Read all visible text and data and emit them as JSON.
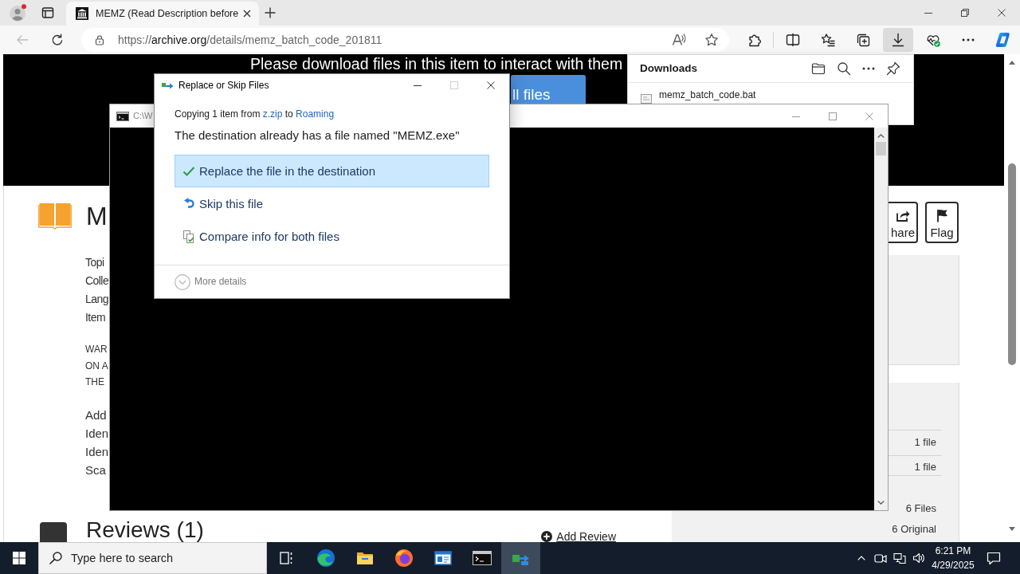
{
  "browser": {
    "tabs": [
      {
        "title": "MEMZ (Read Description before",
        "selected": true
      }
    ],
    "back_disabled": true,
    "url": {
      "scheme": "https://",
      "host": "archive.org",
      "path": "/details/memz_batch_code_201811"
    },
    "toolbar": [
      {
        "kind": "extensions",
        "active": false
      },
      {
        "kind": "split_screen",
        "active": false
      },
      {
        "kind": "favorites",
        "active": false
      },
      {
        "kind": "collections",
        "active": false
      },
      {
        "kind": "downloads",
        "active": true
      },
      {
        "kind": "essentials",
        "active": false
      },
      {
        "kind": "more",
        "active": false
      },
      {
        "kind": "assistant",
        "active": false
      }
    ]
  },
  "page": {
    "banner": {
      "notice": "Please download files in this item to interact with them",
      "button": "ll files"
    },
    "title": "M",
    "metadata": [
      "Topi",
      "Colle",
      "Lang",
      "Item"
    ],
    "warning": [
      "WAR",
      "ON A",
      "THE"
    ],
    "details": [
      "Add",
      "Iden",
      "Iden",
      "Sca"
    ],
    "actions": [
      {
        "kind": "share",
        "label": "hare"
      },
      {
        "kind": "flag",
        "label": "Flag"
      }
    ],
    "file_rows": [
      "1 file",
      "1 file"
    ],
    "totals": [
      "6 Files",
      "6 Original"
    ],
    "reviews": {
      "heading": "Reviews (1)",
      "add": "Add Review"
    }
  },
  "downloads_panel": {
    "title": "Downloads",
    "items": [
      {
        "name": "memz_batch_code.bat"
      }
    ]
  },
  "console_window": {
    "title": "C:\\W"
  },
  "dialog": {
    "title": "Replace or Skip Files",
    "maximize_disabled": true,
    "copy_line": {
      "prefix": "Copying 1 item from",
      "source": "z.zip",
      "joiner": "to",
      "destination": "Roaming"
    },
    "message": "The destination already has a file named \"MEMZ.exe\"",
    "options": [
      {
        "kind": "replace",
        "label": "Replace the file in the destination",
        "selected": true
      },
      {
        "kind": "skip",
        "label": "Skip this file",
        "selected": false
      },
      {
        "kind": "compare",
        "label": "Compare info for both files",
        "selected": false
      }
    ],
    "more_details": "More details"
  },
  "taskbar": {
    "search_placeholder": "Type here to search",
    "apps": [
      {
        "kind": "task_view",
        "selected": false
      },
      {
        "kind": "swirl",
        "selected": false
      },
      {
        "kind": "folder",
        "selected": false
      },
      {
        "kind": "globe",
        "selected": false
      },
      {
        "kind": "app_window",
        "selected": false
      },
      {
        "kind": "terminal",
        "selected": false
      },
      {
        "kind": "transfer",
        "selected": true
      }
    ],
    "time": "6:21 PM",
    "date": "4/29/2025"
  }
}
